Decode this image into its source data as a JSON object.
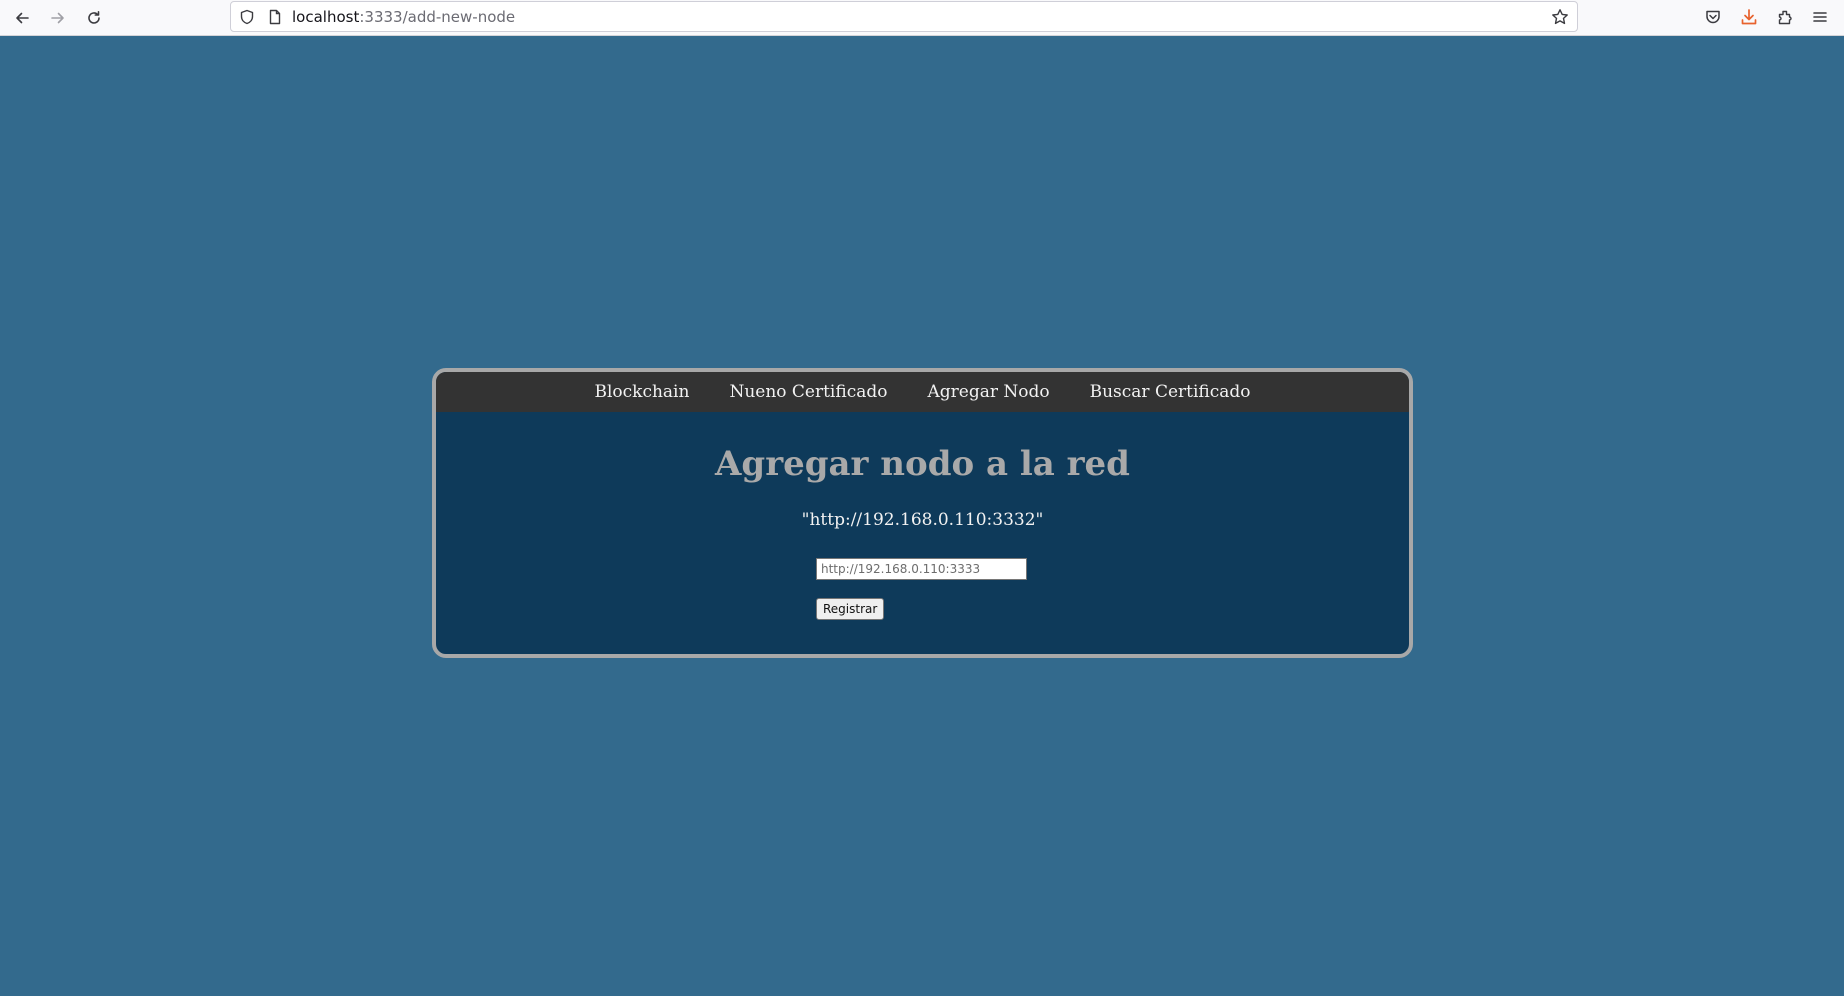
{
  "browser": {
    "url_host": "localhost",
    "url_path": ":3333/add-new-node",
    "icons": [
      "back-icon",
      "forward-icon",
      "reload-icon",
      "shield-icon",
      "page-icon",
      "bookmark-star-icon",
      "pocket-icon",
      "download-icon",
      "extensions-icon",
      "menu-icon"
    ]
  },
  "colors": {
    "page_background": "#336a8d",
    "card_background": "#0e3a5a",
    "nav_background": "#333333",
    "title_color": "#a9a9a9",
    "download_accent": "#e8622d"
  },
  "nav": {
    "items": [
      {
        "label": "Blockchain"
      },
      {
        "label": "Nueno Certificado"
      },
      {
        "label": "Agregar Nodo"
      },
      {
        "label": "Buscar Certificado"
      }
    ]
  },
  "main": {
    "title": "Agregar nodo a la red",
    "node_url": "\"http://192.168.0.110:3332\"",
    "input": {
      "value": "",
      "placeholder": "http://192.168.0.110:3333"
    },
    "register_label": "Registrar"
  }
}
